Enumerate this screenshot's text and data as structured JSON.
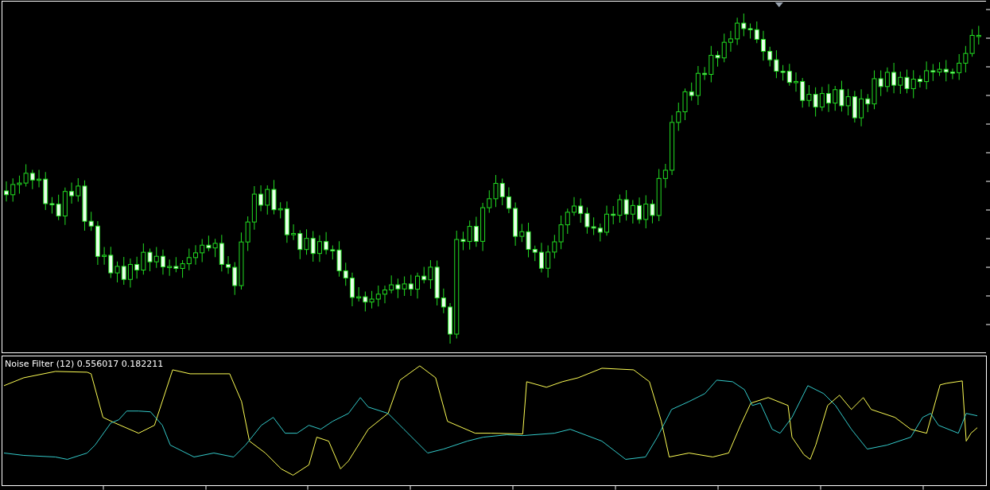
{
  "indicator": {
    "label": "Noise Filter (12) 0.556017 0.182211"
  }
}
